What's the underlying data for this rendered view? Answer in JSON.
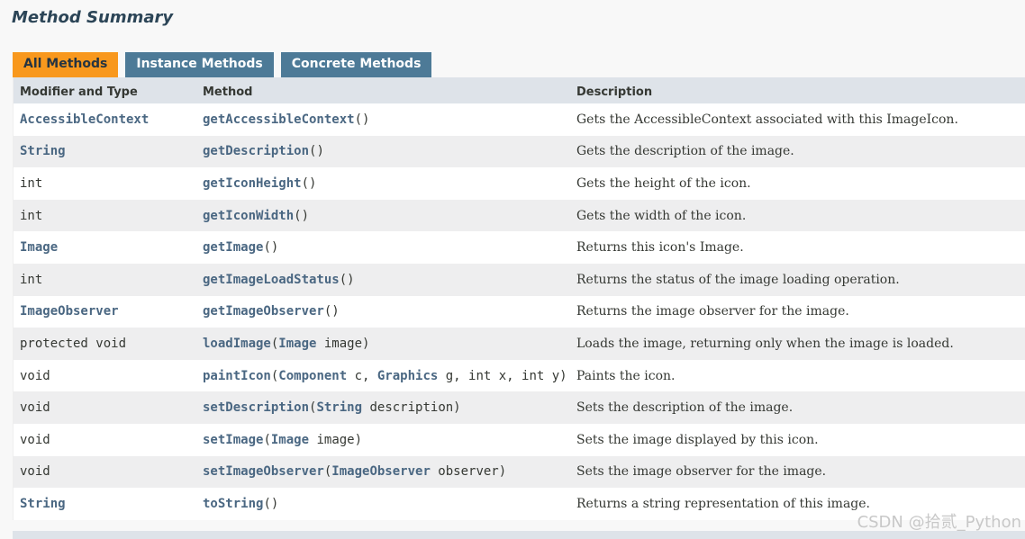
{
  "section": {
    "title": "Method Summary"
  },
  "tabs": [
    {
      "label": "All Methods",
      "active": true
    },
    {
      "label": "Instance Methods",
      "active": false
    },
    {
      "label": "Concrete Methods",
      "active": false
    }
  ],
  "columns": [
    "Modifier and Type",
    "Method",
    "Description"
  ],
  "rows": [
    {
      "type": [
        {
          "t": "AccessibleContext",
          "link": true
        }
      ],
      "method": [
        {
          "t": "getAccessibleContext",
          "link": true
        },
        {
          "t": "()",
          "link": false
        }
      ],
      "description": "Gets the AccessibleContext associated with this ImageIcon."
    },
    {
      "type": [
        {
          "t": "String",
          "link": true
        }
      ],
      "method": [
        {
          "t": "getDescription",
          "link": true
        },
        {
          "t": "()",
          "link": false
        }
      ],
      "description": "Gets the description of the image."
    },
    {
      "type": [
        {
          "t": "int",
          "link": false
        }
      ],
      "method": [
        {
          "t": "getIconHeight",
          "link": true
        },
        {
          "t": "()",
          "link": false
        }
      ],
      "description": "Gets the height of the icon."
    },
    {
      "type": [
        {
          "t": "int",
          "link": false
        }
      ],
      "method": [
        {
          "t": "getIconWidth",
          "link": true
        },
        {
          "t": "()",
          "link": false
        }
      ],
      "description": "Gets the width of the icon."
    },
    {
      "type": [
        {
          "t": "Image",
          "link": true
        }
      ],
      "method": [
        {
          "t": "getImage",
          "link": true
        },
        {
          "t": "()",
          "link": false
        }
      ],
      "description": "Returns this icon's Image."
    },
    {
      "type": [
        {
          "t": "int",
          "link": false
        }
      ],
      "method": [
        {
          "t": "getImageLoadStatus",
          "link": true
        },
        {
          "t": "()",
          "link": false
        }
      ],
      "description": "Returns the status of the image loading operation."
    },
    {
      "type": [
        {
          "t": "ImageObserver",
          "link": true
        }
      ],
      "method": [
        {
          "t": "getImageObserver",
          "link": true
        },
        {
          "t": "()",
          "link": false
        }
      ],
      "description": "Returns the image observer for the image."
    },
    {
      "type": [
        {
          "t": "protected void",
          "link": false
        }
      ],
      "method": [
        {
          "t": "loadImage",
          "link": true
        },
        {
          "t": "(",
          "link": false
        },
        {
          "t": "Image",
          "link": true
        },
        {
          "t": " image)",
          "link": false
        }
      ],
      "description": "Loads the image, returning only when the image is loaded."
    },
    {
      "type": [
        {
          "t": "void",
          "link": false
        }
      ],
      "method": [
        {
          "t": "paintIcon",
          "link": true
        },
        {
          "t": "(",
          "link": false
        },
        {
          "t": "Component",
          "link": true
        },
        {
          "t": " c, ",
          "link": false
        },
        {
          "t": "Graphics",
          "link": true
        },
        {
          "t": " g, int x, int y)",
          "link": false
        }
      ],
      "description": "Paints the icon."
    },
    {
      "type": [
        {
          "t": "void",
          "link": false
        }
      ],
      "method": [
        {
          "t": "setDescription",
          "link": true
        },
        {
          "t": "(",
          "link": false
        },
        {
          "t": "String",
          "link": true
        },
        {
          "t": " description)",
          "link": false
        }
      ],
      "description": "Sets the description of the image."
    },
    {
      "type": [
        {
          "t": "void",
          "link": false
        }
      ],
      "method": [
        {
          "t": "setImage",
          "link": true
        },
        {
          "t": "(",
          "link": false
        },
        {
          "t": "Image",
          "link": true
        },
        {
          "t": " image)",
          "link": false
        }
      ],
      "description": "Sets the image displayed by this icon."
    },
    {
      "type": [
        {
          "t": "void",
          "link": false
        }
      ],
      "method": [
        {
          "t": "setImageObserver",
          "link": true
        },
        {
          "t": "(",
          "link": false
        },
        {
          "t": "ImageObserver",
          "link": true
        },
        {
          "t": " observer)",
          "link": false
        }
      ],
      "description": "Sets the image observer for the image."
    },
    {
      "type": [
        {
          "t": "String",
          "link": true
        }
      ],
      "method": [
        {
          "t": "toString",
          "link": true
        },
        {
          "t": "()",
          "link": false
        }
      ],
      "description": "Returns a string representation of this image."
    }
  ],
  "watermark": "CSDN @拾贰_Python",
  "colors": {
    "active_tab": "#f8981d",
    "inactive_tab": "#4d7a97",
    "header_bg": "#dee3e9",
    "link": "#4a6782",
    "text": "#353833",
    "row_alt": "#eeeeef"
  }
}
